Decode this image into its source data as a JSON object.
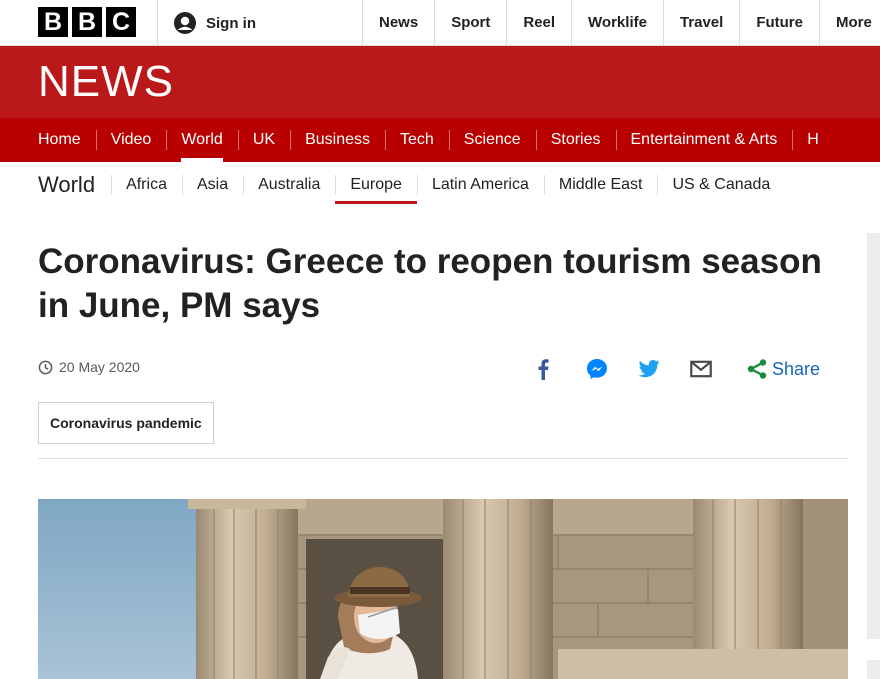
{
  "brand": {
    "letters": [
      "B",
      "B",
      "C"
    ]
  },
  "account": {
    "signin_label": "Sign in"
  },
  "top_nav": [
    "News",
    "Sport",
    "Reel",
    "Worklife",
    "Travel",
    "Future",
    "More"
  ],
  "masthead": {
    "wordmark": "NEWS"
  },
  "section_nav": {
    "items": [
      "Home",
      "Video",
      "World",
      "UK",
      "Business",
      "Tech",
      "Science",
      "Stories",
      "Entertainment & Arts",
      "H"
    ],
    "active": "World"
  },
  "sub_nav": {
    "title": "World",
    "items": [
      "Africa",
      "Asia",
      "Australia",
      "Europe",
      "Latin America",
      "Middle East",
      "US & Canada"
    ],
    "active": "Europe"
  },
  "article": {
    "headline": "Coronavirus: Greece to reopen tourism season in June, PM says",
    "date": "20 May 2020",
    "tag": "Coronavirus pandemic"
  },
  "share": {
    "icons": [
      "facebook-icon",
      "messenger-icon",
      "twitter-icon",
      "email-icon",
      "share-icon"
    ],
    "label": "Share"
  },
  "colors": {
    "news_red": "#bb1919",
    "section_red": "#b80000",
    "facebook": "#3b5998",
    "messenger": "#0084ff",
    "twitter": "#1da1f2",
    "share_blue": "#1866b8"
  }
}
